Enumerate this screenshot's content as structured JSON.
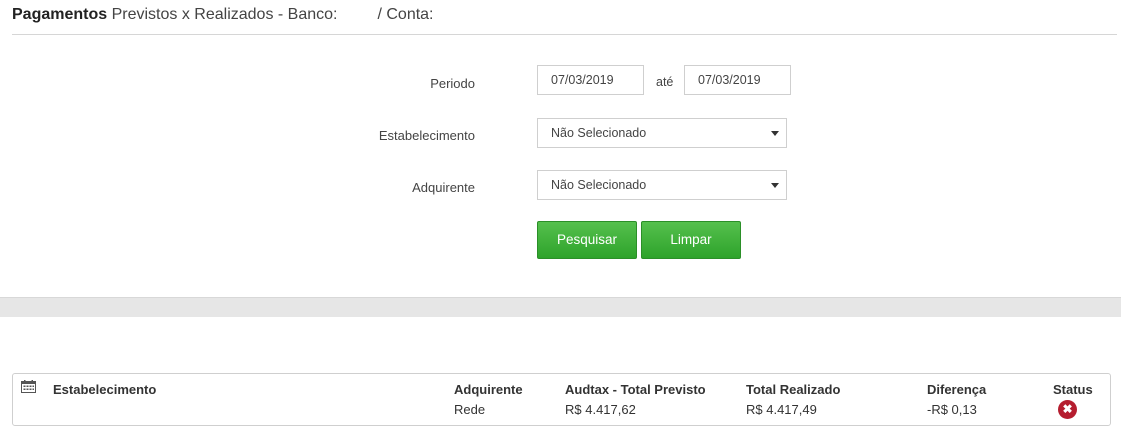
{
  "header": {
    "title_bold": "Pagamentos",
    "title_rest": "Previstos x Realizados - Banco:",
    "conta_label": "/ Conta:"
  },
  "form": {
    "periodo_label": "Periodo",
    "date_from": "07/03/2019",
    "ate_label": "até",
    "date_to": "07/03/2019",
    "estabelecimento_label": "Estabelecimento",
    "estabelecimento_value": "Não Selecionado",
    "adquirente_label": "Adquirente",
    "adquirente_value": "Não Selecionado",
    "search_button": "Pesquisar",
    "clear_button": "Limpar"
  },
  "results": {
    "columns": {
      "estabelecimento": "Estabelecimento",
      "adquirente": "Adquirente",
      "total_previsto": "Audtax - Total Previsto",
      "total_realizado": "Total Realizado",
      "diferenca": "Diferença",
      "status": "Status"
    },
    "row": {
      "estabelecimento": "",
      "adquirente": "Rede",
      "total_previsto": "R$ 4.417,62",
      "total_realizado": "R$ 4.417,49",
      "diferenca": "-R$ 0,13",
      "status_icon": "error-x-icon"
    }
  },
  "colors": {
    "button_green": "#3cb038",
    "status_error": "#b51d2f"
  }
}
